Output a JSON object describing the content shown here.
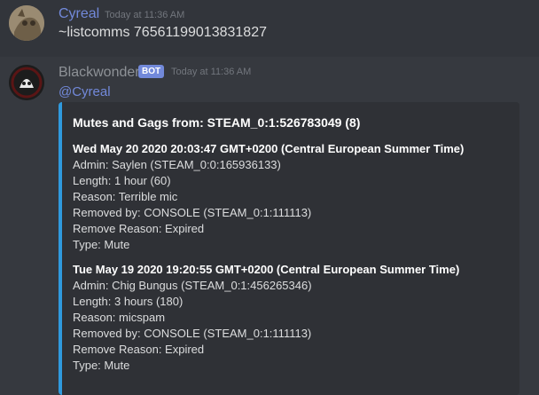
{
  "messages": [
    {
      "username": "Cyreal",
      "timestamp": "Today at 11:36 AM",
      "text": "~listcomms 76561199013831827"
    },
    {
      "username": "Blackwonder",
      "badge": "BOT",
      "timestamp": "Today at 11:36 AM",
      "mention": "@Cyreal",
      "embed": {
        "title": "Mutes and Gags from: STEAM_0:1:526783049 (8)",
        "entries": [
          {
            "date": "Wed May 20 2020 20:03:47 GMT+0200 (Central European Summer Time)",
            "lines": [
              "Admin: Saylen (STEAM_0:0:165936133)",
              "Length: 1 hour (60)",
              "Reason: Terrible mic",
              "Removed by: CONSOLE (STEAM_0:1:111113)",
              "Remove Reason: Expired",
              "Type: Mute"
            ]
          },
          {
            "date": "Tue May 19 2020 19:20:55 GMT+0200 (Central European Summer Time)",
            "lines": [
              "Admin: Chig Bungus (STEAM_0:1:456265346)",
              "Length: 3 hours (180)",
              "Reason: micspam",
              "Removed by: CONSOLE (STEAM_0:1:111113)",
              "Remove Reason: Expired",
              "Type: Mute"
            ]
          }
        ]
      }
    }
  ],
  "colors": {
    "username_link": "#7289da",
    "embed_border": "#2f9ade",
    "background": "#36393f"
  }
}
